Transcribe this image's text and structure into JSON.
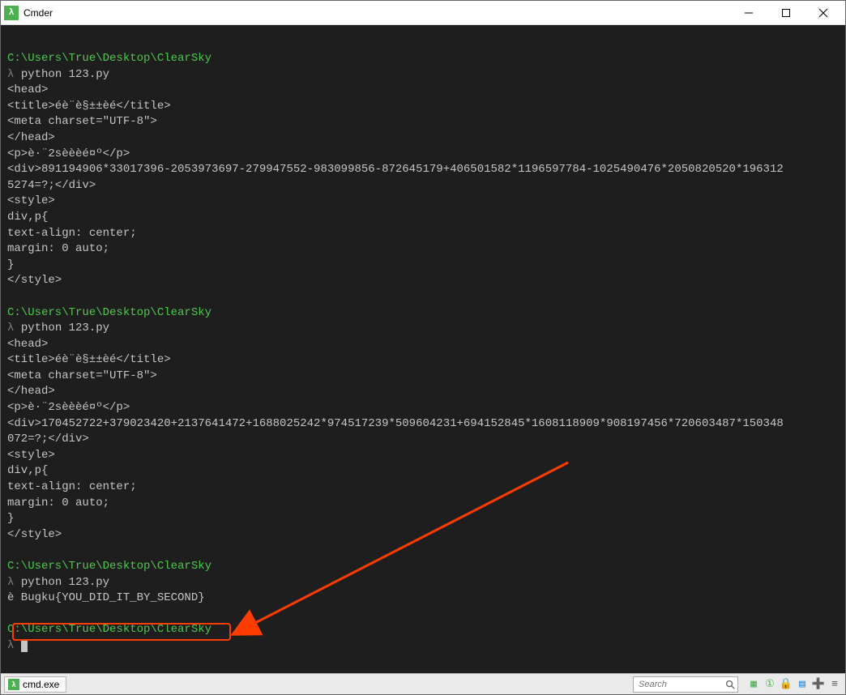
{
  "window": {
    "title": "Cmder",
    "icon_glyph": "λ"
  },
  "terminal": {
    "blocks": [
      {
        "path": "C:\\Users\\True\\Desktop\\ClearSky",
        "command": "python 123.py",
        "output": [
          "<head>",
          "<title>éè¨è§±±èé</title>",
          "<meta charset=\"UTF-8\">",
          "</head>",
          "<p>è·¨2sèèèé¤º</p>",
          "<div>891194906*33017396-2053973697-279947552-983099856-872645179+406501582*1196597784-1025490476*2050820520*196312",
          "5274=?;</div>",
          "<style>",
          "div,p{",
          "text-align: center;",
          "margin: 0 auto;",
          "}",
          "</style>"
        ]
      },
      {
        "path": "C:\\Users\\True\\Desktop\\ClearSky",
        "command": "python 123.py",
        "output": [
          "<head>",
          "<title>éè¨è§±±èé</title>",
          "<meta charset=\"UTF-8\">",
          "</head>",
          "<p>è·¨2sèèèé¤º</p>",
          "<div>170452722+379023420+2137641472+1688025242*974517239*509604231+694152845*1608118909*908197456*720603487*150348",
          "072=?;</div>",
          "<style>",
          "div,p{",
          "text-align: center;",
          "margin: 0 auto;",
          "}",
          "</style>"
        ]
      },
      {
        "path": "C:\\Users\\True\\Desktop\\ClearSky",
        "command": "python 123.py",
        "output": [
          "è Bugku{YOU_DID_IT_BY_SECOND}"
        ]
      },
      {
        "path": "C:\\Users\\True\\Desktop\\ClearSky",
        "command": "",
        "output": []
      }
    ],
    "lambda": "λ",
    "highlight_text": "Bugku{YOU_DID_IT_BY_SECOND}"
  },
  "statusbar": {
    "tab_label": "cmd.exe",
    "search_placeholder": "Search"
  },
  "colors": {
    "accent_green": "#4ec94e",
    "arrow": "#ff3c00"
  }
}
